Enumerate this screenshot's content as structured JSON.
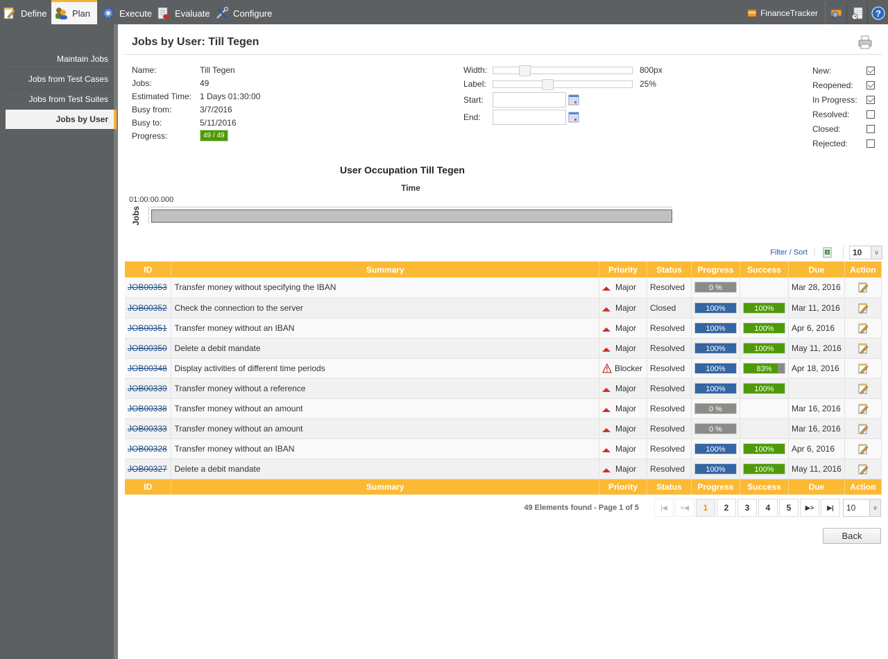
{
  "topnav": {
    "tabs": [
      {
        "label": "Define",
        "icon": "define-icon",
        "active": false
      },
      {
        "label": "Plan",
        "icon": "plan-icon",
        "active": true
      },
      {
        "label": "Execute",
        "icon": "execute-gear-icon",
        "active": false
      },
      {
        "label": "Evaluate",
        "icon": "evaluate-icon",
        "active": false
      },
      {
        "label": "Configure",
        "icon": "configure-tools-icon",
        "active": false
      }
    ],
    "project": "FinanceTracker",
    "right_icons": [
      "project-search-icon",
      "report-clock-icon",
      "help-icon"
    ]
  },
  "sidebar": {
    "items": [
      {
        "label": "Maintain Jobs",
        "active": false
      },
      {
        "label": "Jobs from Test Cases",
        "active": false
      },
      {
        "label": "Jobs from Test Suites",
        "active": false
      },
      {
        "label": "Jobs by User",
        "active": true
      }
    ]
  },
  "page": {
    "title": "Jobs by User: Till Tegen",
    "info": [
      {
        "label": "Name:",
        "value": "Till Tegen"
      },
      {
        "label": "Jobs:",
        "value": "49"
      },
      {
        "label": "Estimated Time:",
        "value": "1 Days 01:30:00"
      },
      {
        "label": "Busy from:",
        "value": "3/7/2016"
      },
      {
        "label": "Busy to:",
        "value": "5/11/2016"
      }
    ],
    "progress_label": "Progress:",
    "progress_value": "49 / 49",
    "controls": {
      "width_label": "Width:",
      "width_value": "800px",
      "width_slider_fraction": 0.2,
      "label_label": "Label:",
      "label_value": "25%",
      "label_slider_fraction": 0.38,
      "start_label": "Start:",
      "start_value": "",
      "end_label": "End:",
      "end_value": ""
    },
    "filters": [
      {
        "label": "New:",
        "checked": true
      },
      {
        "label": "Reopened:",
        "checked": true
      },
      {
        "label": "In Progress:",
        "checked": true
      },
      {
        "label": "Resolved:",
        "checked": false
      },
      {
        "label": "Closed:",
        "checked": false
      },
      {
        "label": "Rejected:",
        "checked": false
      }
    ]
  },
  "chart_data": {
    "type": "bar",
    "title": "User Occupation Till Tegen",
    "xlabel": "Time",
    "ylabel": "Jobs",
    "tick_labels": [
      "01:00:00.000"
    ],
    "series": [
      {
        "name": "Jobs",
        "values": [
          1
        ]
      }
    ],
    "bar_color": "#c0c0c0"
  },
  "table": {
    "toolbar": {
      "filter_sort": "Filter / Sort",
      "page_size": "10"
    },
    "columns": [
      "ID",
      "Summary",
      "Priority",
      "Status",
      "Progress",
      "Success",
      "Due",
      "Action"
    ],
    "rows": [
      {
        "id": "JOB00353",
        "summary": "Transfer money without specifying the IBAN",
        "priority": "Major",
        "status": "Resolved",
        "progress": 0,
        "progress_label": "0 %",
        "success": null,
        "success_label": "",
        "due": "Mar 28, 2016"
      },
      {
        "id": "JOB00352",
        "summary": "Check the connection to the server",
        "priority": "Major",
        "status": "Closed",
        "progress": 100,
        "progress_label": "100%",
        "success": 100,
        "success_label": "100%",
        "due": "Mar 11, 2016"
      },
      {
        "id": "JOB00351",
        "summary": "Transfer money without an IBAN",
        "priority": "Major",
        "status": "Resolved",
        "progress": 100,
        "progress_label": "100%",
        "success": 100,
        "success_label": "100%",
        "due": "Apr 6, 2016"
      },
      {
        "id": "JOB00350",
        "summary": "Delete a debit mandate",
        "priority": "Major",
        "status": "Resolved",
        "progress": 100,
        "progress_label": "100%",
        "success": 100,
        "success_label": "100%",
        "due": "May 11, 2016"
      },
      {
        "id": "JOB00348",
        "summary": "Display activities of different time periods",
        "priority": "Blocker",
        "status": "Resolved",
        "progress": 100,
        "progress_label": "100%",
        "success": 83,
        "success_label": "83%",
        "due": "Apr 18, 2016"
      },
      {
        "id": "JOB00339",
        "summary": "Transfer money without a reference",
        "priority": "Major",
        "status": "Resolved",
        "progress": 100,
        "progress_label": "100%",
        "success": 100,
        "success_label": "100%",
        "due": ""
      },
      {
        "id": "JOB00338",
        "summary": "Transfer money without an amount",
        "priority": "Major",
        "status": "Resolved",
        "progress": 0,
        "progress_label": "0 %",
        "success": null,
        "success_label": "",
        "due": "Mar 16, 2016"
      },
      {
        "id": "JOB00333",
        "summary": "Transfer money without an amount",
        "priority": "Major",
        "status": "Resolved",
        "progress": 0,
        "progress_label": "0 %",
        "success": null,
        "success_label": "",
        "due": "Mar 16, 2016"
      },
      {
        "id": "JOB00328",
        "summary": "Transfer money without an IBAN",
        "priority": "Major",
        "status": "Resolved",
        "progress": 100,
        "progress_label": "100%",
        "success": 100,
        "success_label": "100%",
        "due": "Apr 6, 2016"
      },
      {
        "id": "JOB00327",
        "summary": "Delete a debit mandate",
        "priority": "Major",
        "status": "Resolved",
        "progress": 100,
        "progress_label": "100%",
        "success": 100,
        "success_label": "100%",
        "due": "May 11, 2016"
      }
    ]
  },
  "pager": {
    "summary": "49 Elements found - Page 1 of 5",
    "first": "|◀",
    "prev": "<◀",
    "pages": [
      "1",
      "2",
      "3",
      "4",
      "5"
    ],
    "current_page": "1",
    "next": "▶>",
    "last": "▶|",
    "page_size": "10"
  },
  "back_label": "Back",
  "colors": {
    "accent": "#fbb934",
    "nav_bg": "#5d6063",
    "progress_blue": "#3465a4",
    "success_green": "#4e9a06",
    "neutral_gray": "#8a8c88",
    "link": "#1f4e8a"
  }
}
